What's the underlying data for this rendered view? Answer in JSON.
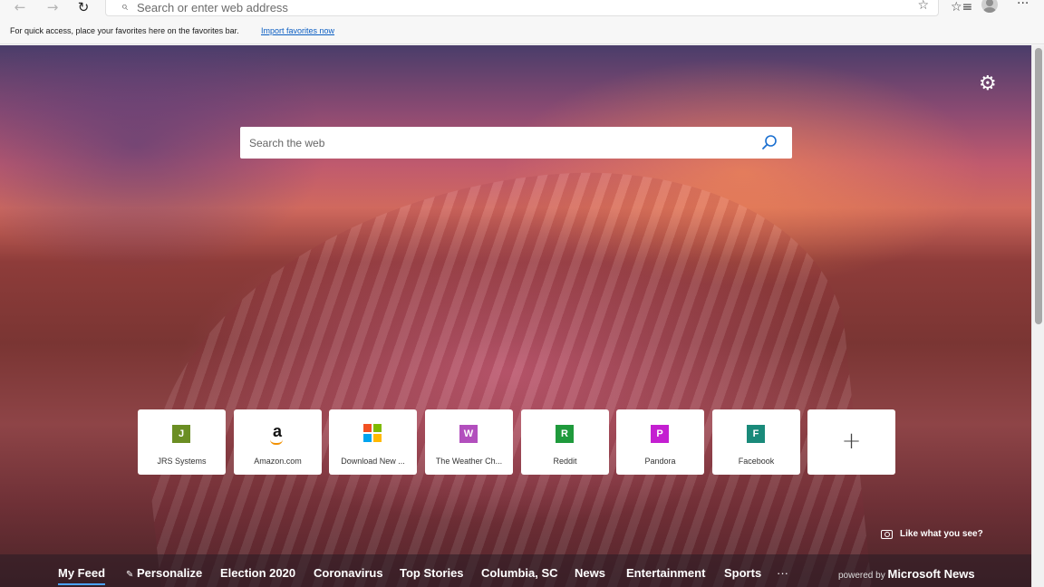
{
  "toolbar": {
    "back_icon": "back-arrow-icon",
    "forward_icon": "forward-arrow-icon",
    "refresh_icon": "refresh-icon",
    "address_placeholder": "Search or enter web address",
    "favorite_icon": "star-icon",
    "favorites_list_icon": "favorites-list-icon",
    "profile_icon": "avatar",
    "menu_icon": "ellipsis-icon"
  },
  "favorites_bar": {
    "message": "For quick access, place your favorites here on the favorites bar.",
    "import_link": "Import favorites now"
  },
  "new_tab": {
    "settings_icon": "gear-icon",
    "search_placeholder": "Search the web",
    "quick_links": [
      {
        "label": "JRS Systems",
        "letter": "J",
        "color": "#6b8e23"
      },
      {
        "label": "Amazon.com",
        "letter": "a",
        "color": "#111111"
      },
      {
        "label": "Download New ...",
        "letter": "",
        "color": "#f25022"
      },
      {
        "label": "The Weather Ch...",
        "letter": "W",
        "color": "#b24fbd"
      },
      {
        "label": "Reddit",
        "letter": "R",
        "color": "#1f9a3c"
      },
      {
        "label": "Pandora",
        "letter": "P",
        "color": "#c41fd1"
      },
      {
        "label": "Facebook",
        "letter": "F",
        "color": "#1a8a7a"
      }
    ],
    "add_tile_icon": "plus-icon",
    "like_text": "Like what you see?"
  },
  "news_nav": {
    "items": [
      "My Feed",
      "Personalize",
      "Election 2020",
      "Coronavirus",
      "Top Stories",
      "Columbia, SC",
      "News",
      "Entertainment",
      "Sports"
    ],
    "more": "···",
    "powered_by": "powered by",
    "brand": "Microsoft News"
  },
  "colors": {
    "accent_link": "#0a5dc2",
    "active_underline": "#4aa3ff"
  }
}
